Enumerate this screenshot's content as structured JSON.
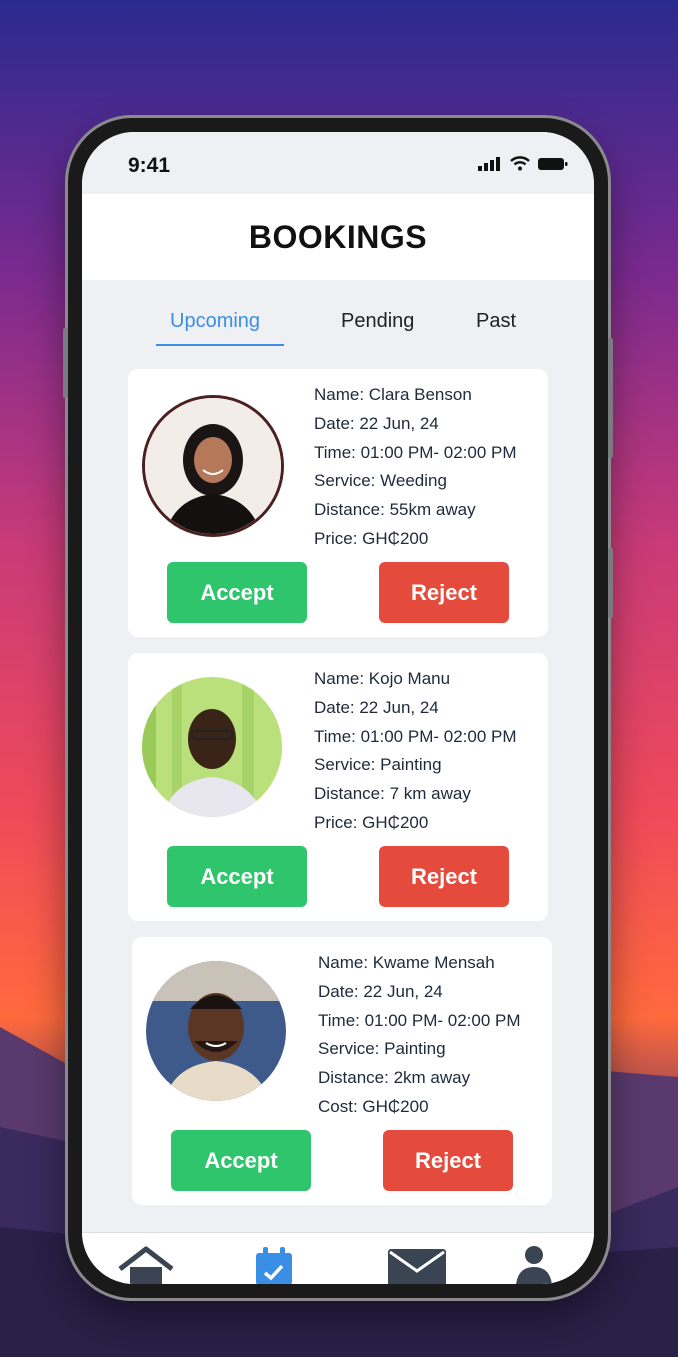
{
  "status_bar": {
    "time": "9:41"
  },
  "header": {
    "title": "BOOKINGS"
  },
  "tabs": [
    {
      "label": "Upcoming",
      "active": true
    },
    {
      "label": "Pending",
      "active": false
    },
    {
      "label": "Past",
      "active": false
    }
  ],
  "bookings": [
    {
      "name": "Name: Clara Benson",
      "date": "Date: 22 Jun, 24",
      "time": "Time: 01:00 PM- 02:00 PM",
      "service": "Service: Weeding",
      "distance": "Distance: 55km away",
      "price": "Price: GH₵200",
      "accept_label": "Accept",
      "reject_label": "Reject"
    },
    {
      "name": "Name: Kojo Manu",
      "date": "Date: 22 Jun, 24",
      "time": "Time: 01:00 PM- 02:00 PM",
      "service": "Service: Painting",
      "distance": "Distance: 7 km  away",
      "price": "Price: GH₵200",
      "accept_label": "Accept",
      "reject_label": "Reject"
    },
    {
      "name": "Name: Kwame Mensah",
      "date": "Date: 22 Jun, 24",
      "time": "Time: 01:00 PM- 02:00 PM",
      "service": "Service: Painting",
      "distance": "Distance: 2km away",
      "price": "Cost: GH₵200",
      "accept_label": "Accept",
      "reject_label": "Reject"
    }
  ],
  "nav": [
    "home-icon",
    "calendar-icon",
    "mail-icon",
    "profile-icon"
  ],
  "colors": {
    "accent": "#3a8ee6",
    "accept": "#2ec56c",
    "reject": "#e54b3c"
  }
}
